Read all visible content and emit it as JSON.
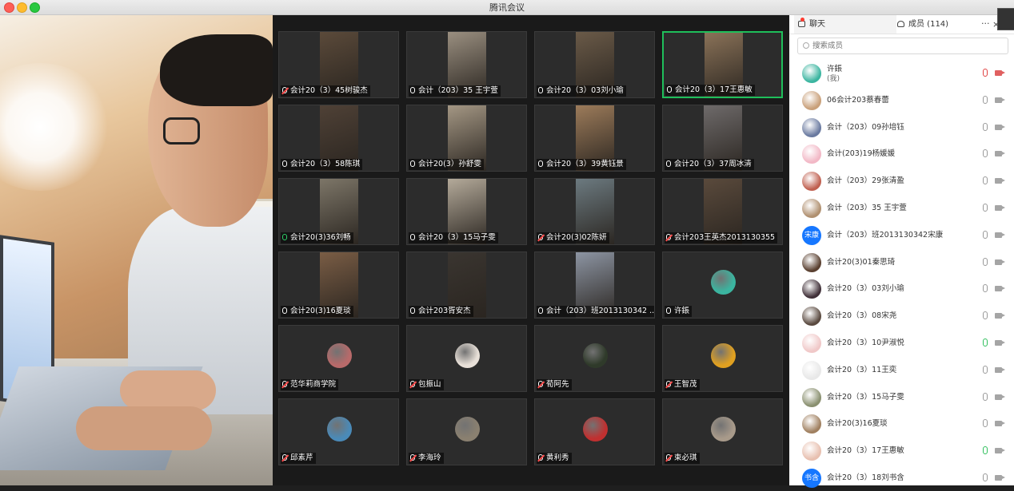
{
  "window": {
    "title": "腾讯会议"
  },
  "grid": {
    "tiles": [
      {
        "name": "会计20（3）45树骏杰",
        "mic": "muted",
        "kind": "video",
        "bg": "#5b4a3a"
      },
      {
        "name": "会计（203）35 王宇萱",
        "mic": "normal",
        "kind": "video",
        "bg": "#9a8f80"
      },
      {
        "name": "会计20（3）03刘小瑜",
        "mic": "normal",
        "kind": "video",
        "bg": "#6a5a48"
      },
      {
        "name": "会计20（3）17王惠敏",
        "mic": "normal",
        "kind": "video",
        "bg": "#8a7258",
        "active": true
      },
      {
        "name": "会计20（3）58陈琪",
        "mic": "normal",
        "kind": "video",
        "bg": "#4f4136"
      },
      {
        "name": "会计20(3）孙舒雯",
        "mic": "normal",
        "kind": "video",
        "bg": "#a49784"
      },
      {
        "name": "会计20（3）39黄钰景",
        "mic": "normal",
        "kind": "video",
        "bg": "#9c7b5a"
      },
      {
        "name": "会计20（3）37周冰清",
        "mic": "normal",
        "kind": "video",
        "bg": "#6e6a6a"
      },
      {
        "name": "会计20(3)36刘畅",
        "mic": "on",
        "kind": "video",
        "bg": "#7d7668"
      },
      {
        "name": "会计20（3）15马子雯",
        "mic": "normal",
        "kind": "video",
        "bg": "#b4aa9a"
      },
      {
        "name": "会计20(3)02陈妍",
        "mic": "muted",
        "kind": "video",
        "bg": "#6c7a80"
      },
      {
        "name": "会计203王英杰2013130355",
        "mic": "muted",
        "kind": "video",
        "bg": "#5a4a3c"
      },
      {
        "name": "会计20(3)16夏琰",
        "mic": "normal",
        "kind": "video",
        "bg": "#7a5d45"
      },
      {
        "name": "会计203胥安杰",
        "mic": "normal",
        "kind": "video",
        "bg": "#3a3530"
      },
      {
        "name": "会计（203）班2013130342 ...",
        "mic": "normal",
        "kind": "video",
        "bg": "#8d95a3"
      },
      {
        "name": "许鋹",
        "mic": "normal",
        "kind": "avatar",
        "bg": "#3bb5a0"
      },
      {
        "name": "范华莉商学院",
        "mic": "muted",
        "kind": "avatar",
        "bg": "#b86a6a"
      },
      {
        "name": "包振山",
        "mic": "muted",
        "kind": "avatar",
        "bg": "#e8e0d8"
      },
      {
        "name": "荀阿先",
        "mic": "muted",
        "kind": "avatar",
        "bg": "#2f3a2a"
      },
      {
        "name": "王智茂",
        "mic": "muted",
        "kind": "avatar",
        "bg": "#e0a020"
      },
      {
        "name": "邱素芹",
        "mic": "muted",
        "kind": "avatar",
        "bg": "#4a8ab8"
      },
      {
        "name": "李海玲",
        "mic": "muted",
        "kind": "avatar",
        "bg": "#8a8070"
      },
      {
        "name": "黄利秀",
        "mic": "muted",
        "kind": "avatar",
        "bg": "#c03030"
      },
      {
        "name": "束必琪",
        "mic": "muted",
        "kind": "avatar",
        "bg": "#a89a8a"
      }
    ]
  },
  "sidebar": {
    "tabs": {
      "chat": "聊天",
      "members": "成员 (114)"
    },
    "more": "···",
    "close": "×",
    "search_placeholder": "搜索成员",
    "members": [
      {
        "name": "许鋹",
        "sub": "(我)",
        "mic": "muted",
        "cam": "off",
        "avatar_color": "#3bb5a0"
      },
      {
        "name": "06会计203蔡春蕾",
        "mic": "normal",
        "cam": "normal",
        "avatar_color": "#c9a07a"
      },
      {
        "name": "会计（203）09孙培钰",
        "mic": "normal",
        "cam": "normal",
        "avatar_color": "#6a7aa0"
      },
      {
        "name": "会计(203)19杨媛媛",
        "mic": "normal",
        "cam": "normal",
        "avatar_color": "#f2b8c6"
      },
      {
        "name": "会计（203）29张清盈",
        "mic": "normal",
        "cam": "normal",
        "avatar_color": "#c06050"
      },
      {
        "name": "会计（203）35 王宇萱",
        "mic": "normal",
        "cam": "normal",
        "avatar_color": "#b09070"
      },
      {
        "name": "会计（203）班2013130342宋康",
        "mic": "normal",
        "cam": "normal",
        "avatar_color": "#1677ff",
        "avatar_text": "宋康"
      },
      {
        "name": "会计20(3)01秦思琦",
        "mic": "normal",
        "cam": "normal",
        "avatar_color": "#5a4030"
      },
      {
        "name": "会计20（3）03刘小瑜",
        "mic": "normal",
        "cam": "normal",
        "avatar_color": "#403038"
      },
      {
        "name": "会计20（3）08宋尧",
        "mic": "normal",
        "cam": "normal",
        "avatar_color": "#5a4a40"
      },
      {
        "name": "会计20（3）10尹淑悦",
        "mic": "on",
        "cam": "normal",
        "avatar_color": "#f0c8c8"
      },
      {
        "name": "会计20（3）11王奕",
        "mic": "normal",
        "cam": "normal",
        "avatar_color": "#e8e8e8"
      },
      {
        "name": "会计20（3）15马子雯",
        "mic": "normal",
        "cam": "normal",
        "avatar_color": "#8a9070"
      },
      {
        "name": "会计20(3)16夏琰",
        "mic": "normal",
        "cam": "normal",
        "avatar_color": "#a08060"
      },
      {
        "name": "会计20（3）17王惠敏",
        "mic": "on",
        "cam": "normal",
        "avatar_color": "#e8c0b0"
      },
      {
        "name": "会计20（3）18刘书含",
        "mic": "normal",
        "cam": "normal",
        "avatar_color": "#1677ff",
        "avatar_text": "书含"
      }
    ]
  }
}
